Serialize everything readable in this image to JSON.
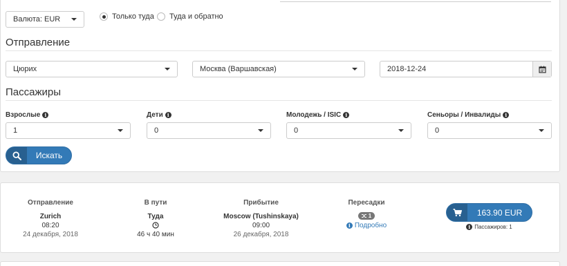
{
  "currency": {
    "value": "Валюта: EUR"
  },
  "trip_type": {
    "one_way": "Только туда",
    "round_trip": "Туда и обратно",
    "selected": "one_way"
  },
  "departure_section": {
    "title": "Отправление",
    "from": "Цюрих",
    "to": "Москва (Варшавская)",
    "date": "2018-12-24"
  },
  "passengers_section": {
    "title": "Пассажиры",
    "adults": {
      "label": "Взрослые",
      "value": "1"
    },
    "children": {
      "label": "Дети",
      "value": "0"
    },
    "youth": {
      "label": "Молодежь / ISIC",
      "value": "0"
    },
    "seniors": {
      "label": "Сеньоры / Инвалиды",
      "value": "0"
    }
  },
  "search_button": {
    "label": "Искать"
  },
  "result": {
    "departure": {
      "header": "Отправление",
      "city": "Zurich",
      "time": "08:20",
      "date": "24 декабря, 2018"
    },
    "duration": {
      "header": "В пути",
      "direction": "Туда",
      "value": "46 ч 40 мин"
    },
    "arrival": {
      "header": "Прибытие",
      "city": "Moscow (Tushinskaya)",
      "time": "09:00",
      "date": "26 декабря, 2018"
    },
    "transfers": {
      "header": "Пересадки",
      "count": "1",
      "details_link": "Подробно"
    },
    "price": {
      "label": "163.90 EUR"
    },
    "passengers_note": "Пассажиров: 1"
  }
}
